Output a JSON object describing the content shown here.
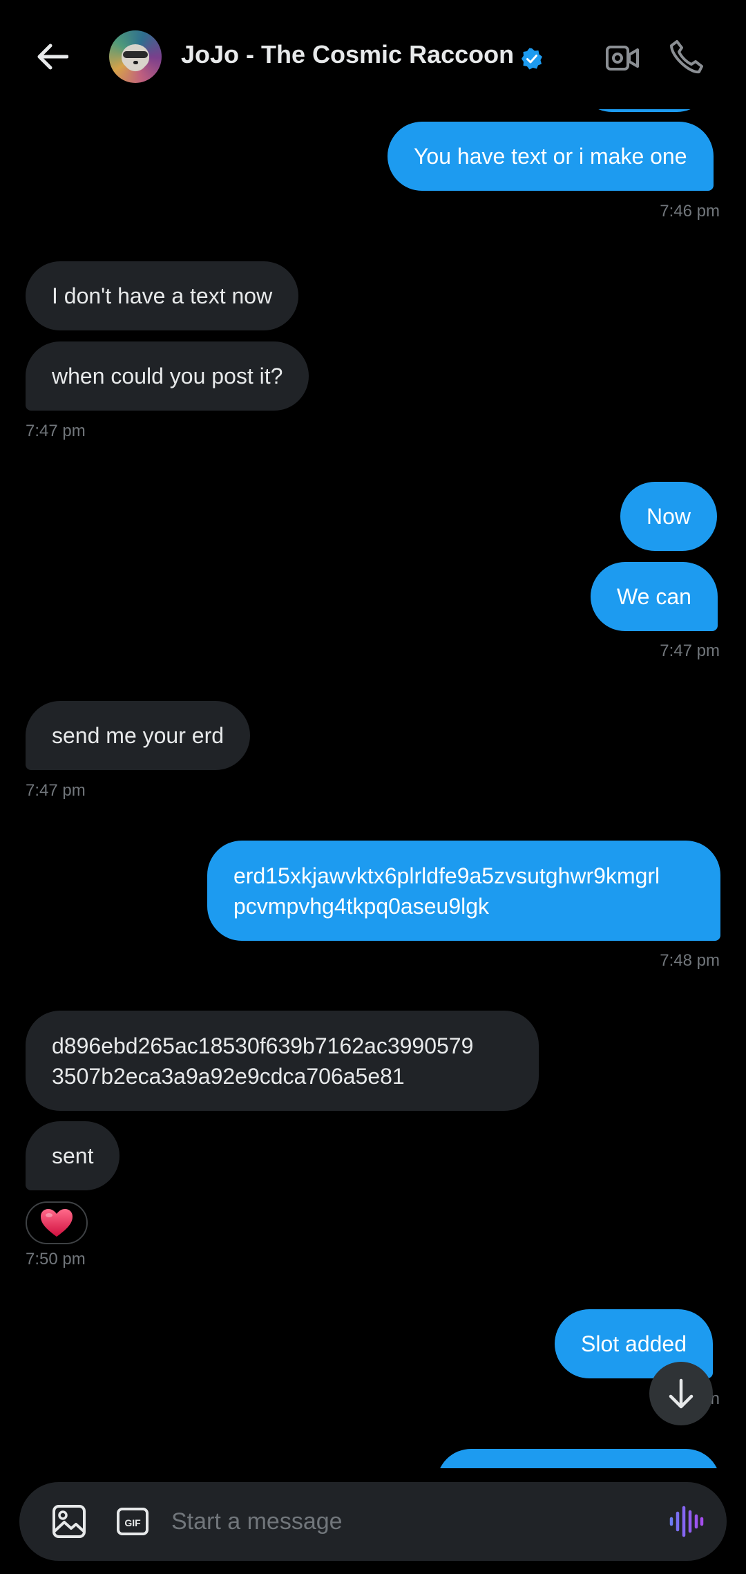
{
  "header": {
    "contact_name": "JoJo - The Cosmic Raccoon"
  },
  "messages": {
    "m1": "You have text or i make one",
    "t1": "7:46 pm",
    "m2": "I don't have a text now",
    "m3": "when could you post it?",
    "t2": "7:47 pm",
    "m4": "Now",
    "m5": "We can",
    "t3": "7:47 pm",
    "m6": "send me your erd",
    "t4": "7:47 pm",
    "m7_line1": "erd15xkjawvktx6plrldfe9a5zvsutghwr9kmgrl",
    "m7_line2": "pcvmpvhg4tkpq0aseu9lgk",
    "t5": "7:48 pm",
    "m8_line1": "d896ebd265ac18530f639b7162ac3990579",
    "m8_line2": "3507b2eca3a9a92e9cdca706a5e81",
    "m9": "sent",
    "reaction": "❤️",
    "t6": "7:50 pm",
    "m10": "Slot added",
    "t7_partial": "n"
  },
  "composer": {
    "placeholder": "Start a message"
  },
  "colors": {
    "background": "#000000",
    "outgoing_bubble": "#1d9bf0",
    "incoming_bubble": "#202327",
    "timestamp": "#71767b",
    "verified": "#1d9bf0",
    "voice_accent": "#8b5cf6"
  },
  "icons": {
    "back": "arrow-left-icon",
    "verified": "verified-badge-icon",
    "video": "video-camera-icon",
    "call": "phone-icon",
    "scroll_down": "arrow-down-icon",
    "media": "image-icon",
    "gif": "gif-icon",
    "voice": "voice-waveform-icon"
  }
}
